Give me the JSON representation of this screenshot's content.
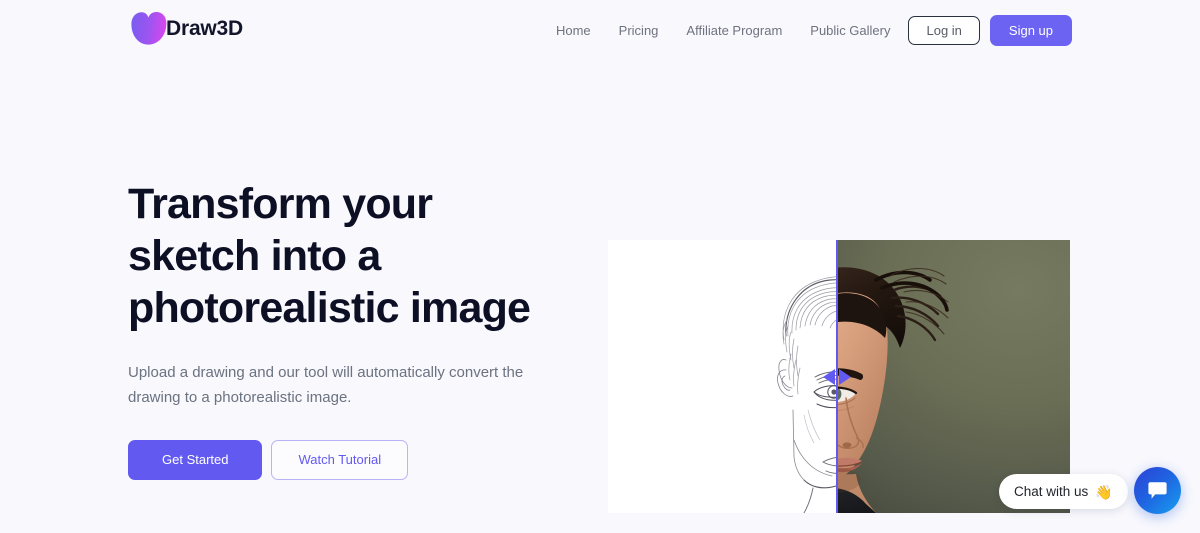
{
  "brand": {
    "name": "Draw3D",
    "logo_gradient_from": "#7b5cf0",
    "logo_gradient_to": "#d946ef"
  },
  "nav": {
    "links": [
      {
        "label": "Home"
      },
      {
        "label": "Pricing"
      },
      {
        "label": "Affiliate Program"
      },
      {
        "label": "Public Gallery"
      }
    ],
    "login_label": "Log in",
    "signup_label": "Sign up",
    "signup_color": "#6c63f3"
  },
  "hero": {
    "title": "Transform your sketch into a photorealistic image",
    "subtitle": "Upload a drawing and our tool will automatically convert the drawing to a photorealistic image.",
    "primary_cta": "Get Started",
    "secondary_cta": "Watch Tutorial",
    "primary_color": "#6259f0"
  },
  "comparison": {
    "left_pane": "pencil-sketch-of-mans-face",
    "right_pane": "photorealistic-portrait-of-man",
    "divider_color": "#6259f0",
    "divider_position_percent": 49
  },
  "chat": {
    "pill_label": "Chat with us",
    "pill_emoji": "👋",
    "fab_icon": "speech-bubble-icon",
    "fab_color": "#1f62e0"
  }
}
